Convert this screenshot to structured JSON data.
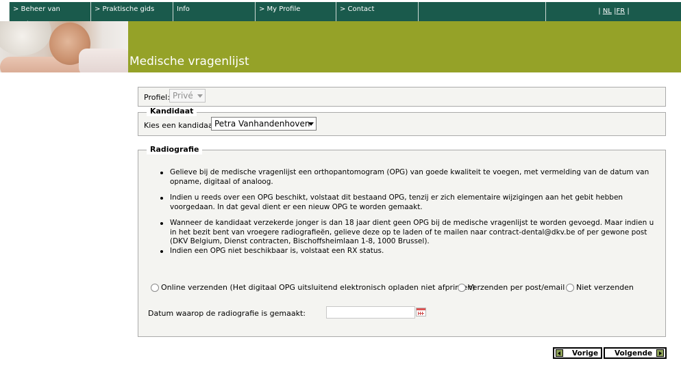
{
  "nav": {
    "items": [
      {
        "label": "> Beheer van tandarts"
      },
      {
        "label": "> Praktische gids"
      },
      {
        "label": "Info"
      },
      {
        "label": "> My Profile"
      },
      {
        "label": "> Contact"
      },
      {
        "label": ""
      }
    ],
    "lang_sep": "|",
    "lang_nl": "NL",
    "lang_fr": "FR"
  },
  "banner": {
    "title": "Medische vragenlijst",
    "accent_color": "#95a228",
    "nav_color": "#1a5a4c"
  },
  "profile": {
    "label": "Profiel:",
    "value": "Privé"
  },
  "candidate": {
    "legend": "Kandidaat",
    "label": "Kies een kandidaat:",
    "value": "Petra Vanhandenhoven"
  },
  "radiography": {
    "legend": "Radiografie",
    "bullets": [
      "Gelieve bij de medische vragenlijst een orthopantomogram (OPG) van goede kwaliteit te voegen, met vermelding van de datum van opname, digitaal of analoog.",
      "Indien u reeds over een OPG beschikt, volstaat dit bestaand OPG, tenzij er zich elementaire wijzigingen aan het gebit hebben voorgedaan. In dat geval dient er een nieuw OPG te worden gemaakt.",
      "Wanneer de kandidaat verzekerde jonger is dan 18 jaar dient geen OPG bij de medische vragenlijst te worden gevoegd. Maar indien u in het bezit bent van vroegere radiografieën, gelieve deze op te laden of te mailen naar contract-dental@dkv.be of per gewone post (DKV Belgium, Dienst contracten, Bischoffsheimlaan 1-8, 1000 Brussel).",
      "Indien een OPG niet beschikbaar is, volstaat een RX status."
    ],
    "options": {
      "online": "Online verzenden (Het digitaal OPG uitsluitend elektronisch opladen niet afprinten)",
      "post": "Verzenden per post/email",
      "none": "Niet verzenden"
    },
    "date_label": "Datum waarop de radiografie is gemaakt:",
    "date_value": "",
    "calendar_icon": "calendar-icon"
  },
  "buttons": {
    "prev": "Vorige",
    "next": "Volgende"
  }
}
